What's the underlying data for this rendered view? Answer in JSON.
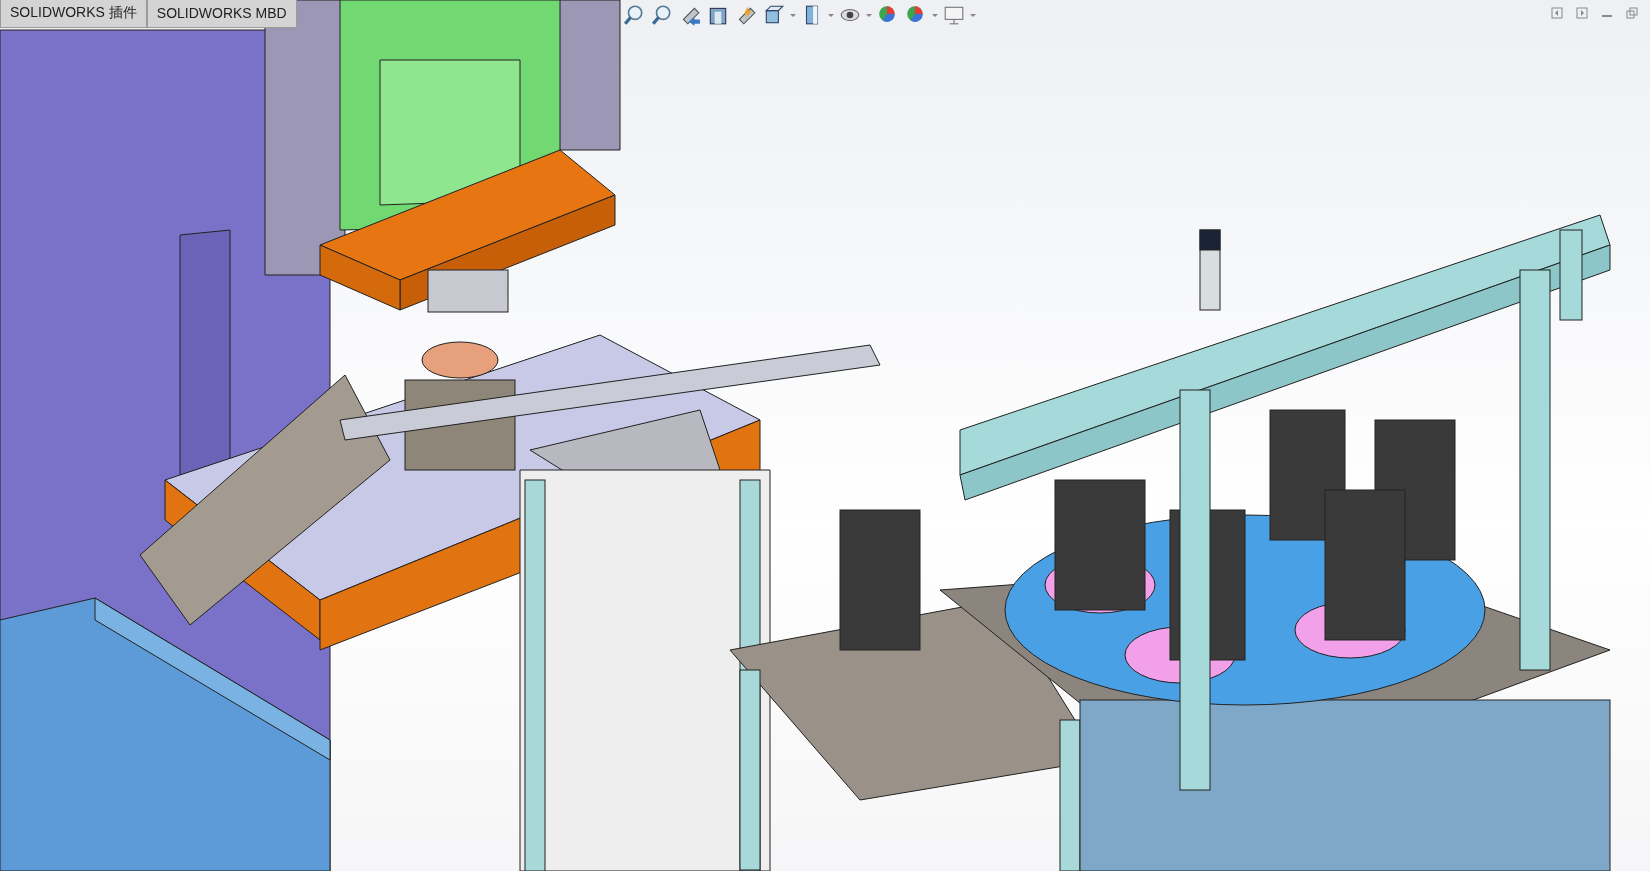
{
  "tabs": [
    {
      "label": "SOLIDWORKS 插件"
    },
    {
      "label": "SOLIDWORKS MBD"
    }
  ],
  "view_toolbar": [
    {
      "kind": "zoom-fit"
    },
    {
      "kind": "zoom-area"
    },
    {
      "kind": "previous-view"
    },
    {
      "kind": "section-view"
    },
    {
      "kind": "dynamic-annotation"
    },
    {
      "kind": "view-orientation"
    },
    {
      "kind": "caret"
    },
    {
      "kind": "display-style"
    },
    {
      "kind": "caret"
    },
    {
      "kind": "hide-show"
    },
    {
      "kind": "caret"
    },
    {
      "kind": "edit-appearance"
    },
    {
      "kind": "apply-scene"
    },
    {
      "kind": "caret"
    },
    {
      "kind": "view-settings"
    },
    {
      "kind": "caret"
    }
  ],
  "window_controls": [
    {
      "kind": "tile-left"
    },
    {
      "kind": "tile-right"
    },
    {
      "kind": "minimize"
    },
    {
      "kind": "restore"
    }
  ]
}
